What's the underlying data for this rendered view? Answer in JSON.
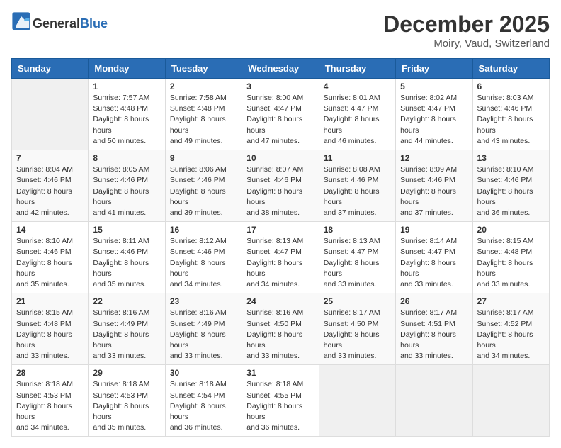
{
  "header": {
    "logo_general": "General",
    "logo_blue": "Blue",
    "title": "December 2025",
    "subtitle": "Moiry, Vaud, Switzerland"
  },
  "calendar": {
    "weekdays": [
      "Sunday",
      "Monday",
      "Tuesday",
      "Wednesday",
      "Thursday",
      "Friday",
      "Saturday"
    ],
    "weeks": [
      [
        {
          "day": "",
          "sunrise": "",
          "sunset": "",
          "daylight": ""
        },
        {
          "day": "1",
          "sunrise": "7:57 AM",
          "sunset": "4:48 PM",
          "daylight": "8 hours and 50 minutes."
        },
        {
          "day": "2",
          "sunrise": "7:58 AM",
          "sunset": "4:48 PM",
          "daylight": "8 hours and 49 minutes."
        },
        {
          "day": "3",
          "sunrise": "8:00 AM",
          "sunset": "4:47 PM",
          "daylight": "8 hours and 47 minutes."
        },
        {
          "day": "4",
          "sunrise": "8:01 AM",
          "sunset": "4:47 PM",
          "daylight": "8 hours and 46 minutes."
        },
        {
          "day": "5",
          "sunrise": "8:02 AM",
          "sunset": "4:47 PM",
          "daylight": "8 hours and 44 minutes."
        },
        {
          "day": "6",
          "sunrise": "8:03 AM",
          "sunset": "4:46 PM",
          "daylight": "8 hours and 43 minutes."
        }
      ],
      [
        {
          "day": "7",
          "sunrise": "8:04 AM",
          "sunset": "4:46 PM",
          "daylight": "8 hours and 42 minutes."
        },
        {
          "day": "8",
          "sunrise": "8:05 AM",
          "sunset": "4:46 PM",
          "daylight": "8 hours and 41 minutes."
        },
        {
          "day": "9",
          "sunrise": "8:06 AM",
          "sunset": "4:46 PM",
          "daylight": "8 hours and 39 minutes."
        },
        {
          "day": "10",
          "sunrise": "8:07 AM",
          "sunset": "4:46 PM",
          "daylight": "8 hours and 38 minutes."
        },
        {
          "day": "11",
          "sunrise": "8:08 AM",
          "sunset": "4:46 PM",
          "daylight": "8 hours and 37 minutes."
        },
        {
          "day": "12",
          "sunrise": "8:09 AM",
          "sunset": "4:46 PM",
          "daylight": "8 hours and 37 minutes."
        },
        {
          "day": "13",
          "sunrise": "8:10 AM",
          "sunset": "4:46 PM",
          "daylight": "8 hours and 36 minutes."
        }
      ],
      [
        {
          "day": "14",
          "sunrise": "8:10 AM",
          "sunset": "4:46 PM",
          "daylight": "8 hours and 35 minutes."
        },
        {
          "day": "15",
          "sunrise": "8:11 AM",
          "sunset": "4:46 PM",
          "daylight": "8 hours and 35 minutes."
        },
        {
          "day": "16",
          "sunrise": "8:12 AM",
          "sunset": "4:46 PM",
          "daylight": "8 hours and 34 minutes."
        },
        {
          "day": "17",
          "sunrise": "8:13 AM",
          "sunset": "4:47 PM",
          "daylight": "8 hours and 34 minutes."
        },
        {
          "day": "18",
          "sunrise": "8:13 AM",
          "sunset": "4:47 PM",
          "daylight": "8 hours and 33 minutes."
        },
        {
          "day": "19",
          "sunrise": "8:14 AM",
          "sunset": "4:47 PM",
          "daylight": "8 hours and 33 minutes."
        },
        {
          "day": "20",
          "sunrise": "8:15 AM",
          "sunset": "4:48 PM",
          "daylight": "8 hours and 33 minutes."
        }
      ],
      [
        {
          "day": "21",
          "sunrise": "8:15 AM",
          "sunset": "4:48 PM",
          "daylight": "8 hours and 33 minutes."
        },
        {
          "day": "22",
          "sunrise": "8:16 AM",
          "sunset": "4:49 PM",
          "daylight": "8 hours and 33 minutes."
        },
        {
          "day": "23",
          "sunrise": "8:16 AM",
          "sunset": "4:49 PM",
          "daylight": "8 hours and 33 minutes."
        },
        {
          "day": "24",
          "sunrise": "8:16 AM",
          "sunset": "4:50 PM",
          "daylight": "8 hours and 33 minutes."
        },
        {
          "day": "25",
          "sunrise": "8:17 AM",
          "sunset": "4:50 PM",
          "daylight": "8 hours and 33 minutes."
        },
        {
          "day": "26",
          "sunrise": "8:17 AM",
          "sunset": "4:51 PM",
          "daylight": "8 hours and 33 minutes."
        },
        {
          "day": "27",
          "sunrise": "8:17 AM",
          "sunset": "4:52 PM",
          "daylight": "8 hours and 34 minutes."
        }
      ],
      [
        {
          "day": "28",
          "sunrise": "8:18 AM",
          "sunset": "4:53 PM",
          "daylight": "8 hours and 34 minutes."
        },
        {
          "day": "29",
          "sunrise": "8:18 AM",
          "sunset": "4:53 PM",
          "daylight": "8 hours and 35 minutes."
        },
        {
          "day": "30",
          "sunrise": "8:18 AM",
          "sunset": "4:54 PM",
          "daylight": "8 hours and 36 minutes."
        },
        {
          "day": "31",
          "sunrise": "8:18 AM",
          "sunset": "4:55 PM",
          "daylight": "8 hours and 36 minutes."
        },
        {
          "day": "",
          "sunrise": "",
          "sunset": "",
          "daylight": ""
        },
        {
          "day": "",
          "sunrise": "",
          "sunset": "",
          "daylight": ""
        },
        {
          "day": "",
          "sunrise": "",
          "sunset": "",
          "daylight": ""
        }
      ]
    ]
  }
}
